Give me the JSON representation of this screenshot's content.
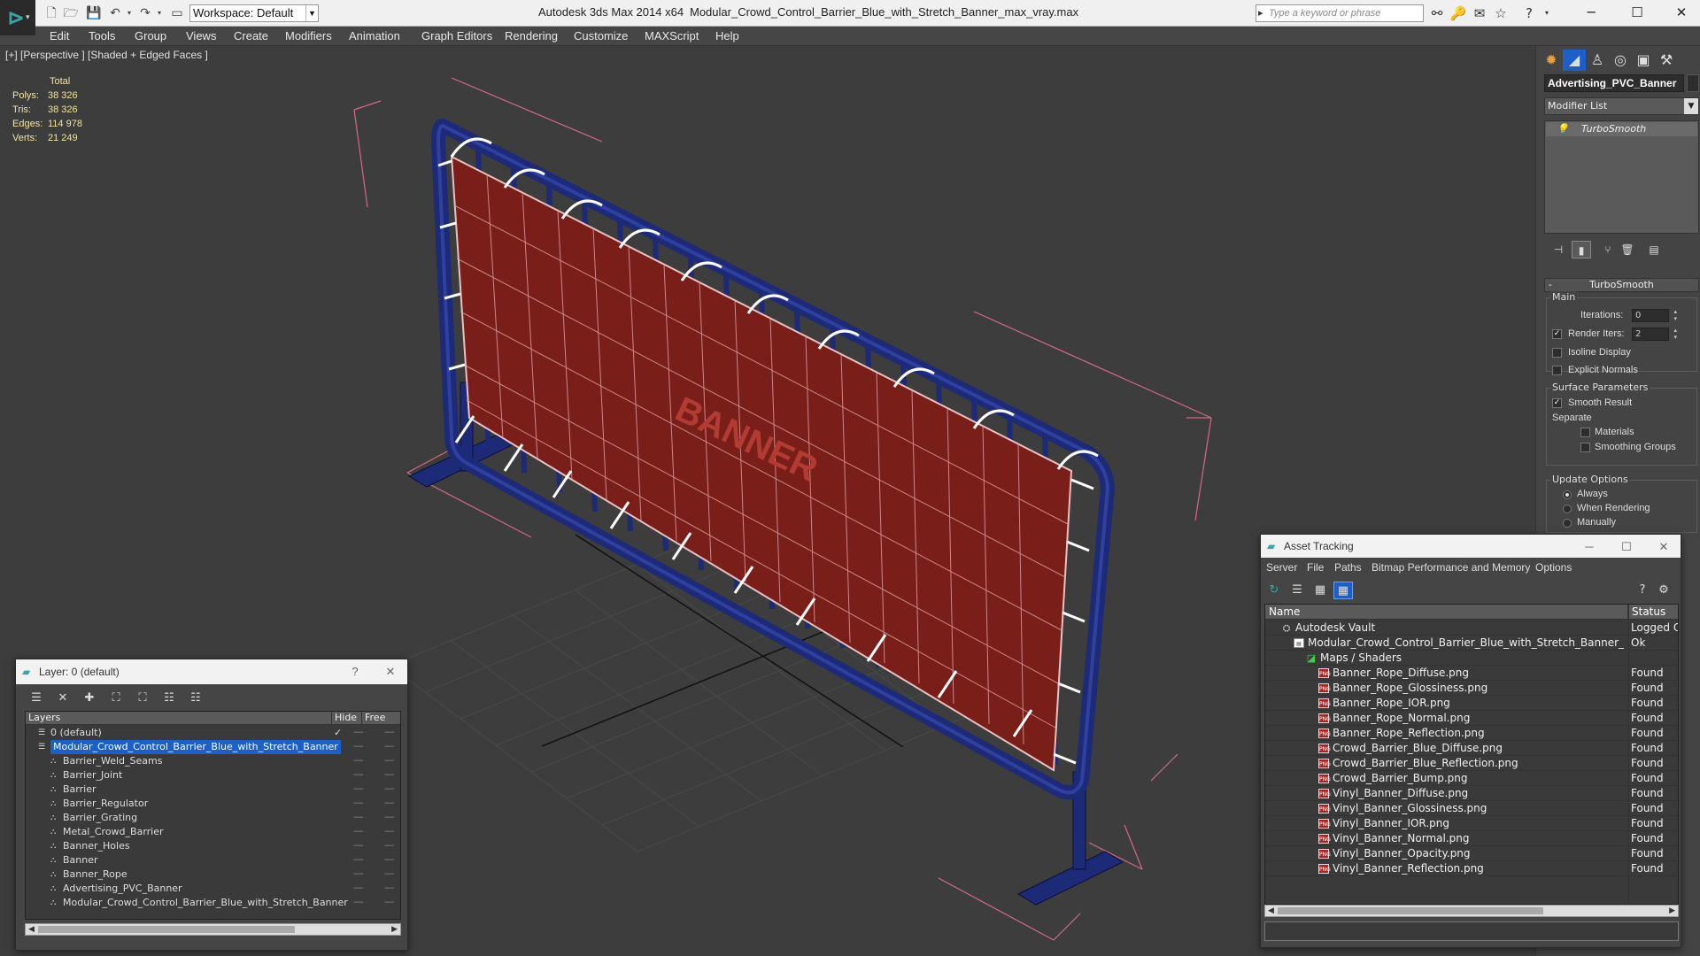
{
  "titlebar": {
    "workspace": "Workspace: Default",
    "app_title": "Autodesk 3ds Max  2014 x64",
    "file_title": "Modular_Crowd_Control_Barrier_Blue_with_Stretch_Banner_max_vray.max",
    "search_placeholder": "Type a keyword or phrase"
  },
  "menu": [
    "Edit",
    "Tools",
    "Group",
    "Views",
    "Create",
    "Modifiers",
    "Animation",
    "Graph Editors",
    "Rendering",
    "Customize",
    "MAXScript",
    "Help"
  ],
  "viewport": {
    "label": "[+] [Perspective ] [Shaded + Edged Faces ]",
    "stats": {
      "header": "Total",
      "rows": [
        {
          "label": "Polys:",
          "value": "38 326"
        },
        {
          "label": "Tris:",
          "value": "38 326"
        },
        {
          "label": "Edges:",
          "value": "114 978"
        },
        {
          "label": "Verts:",
          "value": "21 249"
        }
      ]
    },
    "banner_text": "BANNER"
  },
  "command_panel": {
    "object_name": "Advertising_PVC_Banner",
    "modifier_list": "Modifier List",
    "stack_item": "TurboSmooth",
    "rollout": "TurboSmooth",
    "main_group": "Main",
    "iterations_label": "Iterations:",
    "iterations_value": "0",
    "render_iters_label": "Render Iters:",
    "render_iters_value": "2",
    "isoline": "Isoline Display",
    "explicit_normals": "Explicit Normals",
    "surface_group": "Surface Parameters",
    "smooth_result": "Smooth Result",
    "separate": "Separate",
    "materials": "Materials",
    "smoothing_groups": "Smoothing Groups",
    "update_group": "Update Options",
    "always": "Always",
    "when_rendering": "When Rendering",
    "manually": "Manually"
  },
  "layer_dialog": {
    "title": "Layer: 0 (default)",
    "help": "?",
    "col_layers": "Layers",
    "col_hide": "Hide",
    "col_freeze": "Free",
    "rows": [
      {
        "name": "0 (default)",
        "level": 0,
        "check": "✓"
      },
      {
        "name": "Modular_Crowd_Control_Barrier_Blue_with_Stretch_Banner",
        "level": 0,
        "selected": true
      },
      {
        "name": "Barrier_Weld_Seams",
        "level": 1
      },
      {
        "name": "Barrier_Joint",
        "level": 1
      },
      {
        "name": "Barrier",
        "level": 1
      },
      {
        "name": "Barrier_Regulator",
        "level": 1
      },
      {
        "name": "Barrier_Grating",
        "level": 1
      },
      {
        "name": "Metal_Crowd_Barrier",
        "level": 1
      },
      {
        "name": "Banner_Holes",
        "level": 1
      },
      {
        "name": "Banner",
        "level": 1
      },
      {
        "name": "Banner_Rope",
        "level": 1
      },
      {
        "name": "Advertising_PVC_Banner",
        "level": 1
      },
      {
        "name": "Modular_Crowd_Control_Barrier_Blue_with_Stretch_Banner",
        "level": 1
      }
    ]
  },
  "asset_dialog": {
    "title": "Asset Tracking",
    "menu": [
      "Server",
      "File",
      "Paths",
      "Bitmap Performance and Memory",
      "Options"
    ],
    "col_name": "Name",
    "col_status": "Status",
    "rows": [
      {
        "name": "Autodesk Vault",
        "status": "Logged O",
        "level": 0,
        "icon": "vault"
      },
      {
        "name": "Modular_Crowd_Control_Barrier_Blue_with_Stretch_Banner_max_v...",
        "status": "Ok",
        "level": 1,
        "icon": "file"
      },
      {
        "name": "Maps / Shaders",
        "status": "",
        "level": 2,
        "icon": "map"
      },
      {
        "name": "Banner_Rope_Diffuse.png",
        "status": "Found",
        "level": 3,
        "icon": "png"
      },
      {
        "name": "Banner_Rope_Glossiness.png",
        "status": "Found",
        "level": 3,
        "icon": "png"
      },
      {
        "name": "Banner_Rope_IOR.png",
        "status": "Found",
        "level": 3,
        "icon": "png"
      },
      {
        "name": "Banner_Rope_Normal.png",
        "status": "Found",
        "level": 3,
        "icon": "png"
      },
      {
        "name": "Banner_Rope_Reflection.png",
        "status": "Found",
        "level": 3,
        "icon": "png"
      },
      {
        "name": "Crowd_Barrier_Blue_Diffuse.png",
        "status": "Found",
        "level": 3,
        "icon": "png"
      },
      {
        "name": "Crowd_Barrier_Blue_Reflection.png",
        "status": "Found",
        "level": 3,
        "icon": "png"
      },
      {
        "name": "Crowd_Barrier_Bump.png",
        "status": "Found",
        "level": 3,
        "icon": "png"
      },
      {
        "name": "Vinyl_Banner_Diffuse.png",
        "status": "Found",
        "level": 3,
        "icon": "png"
      },
      {
        "name": "Vinyl_Banner_Glossiness.png",
        "status": "Found",
        "level": 3,
        "icon": "png"
      },
      {
        "name": "Vinyl_Banner_IOR.png",
        "status": "Found",
        "level": 3,
        "icon": "png"
      },
      {
        "name": "Vinyl_Banner_Normal.png",
        "status": "Found",
        "level": 3,
        "icon": "png"
      },
      {
        "name": "Vinyl_Banner_Opacity.png",
        "status": "Found",
        "level": 3,
        "icon": "png"
      },
      {
        "name": "Vinyl_Banner_Reflection.png",
        "status": "Found",
        "level": 3,
        "icon": "png"
      }
    ]
  },
  "colors": {
    "viewport_bg": "#3d3d3d",
    "barrier_blue": "#1d2a78",
    "banner_red": "#7a1e1a",
    "selection_blue": "#1c5fc8",
    "bbox_pink": "#d46a84",
    "stats_yellow": "#f0e4a0"
  }
}
